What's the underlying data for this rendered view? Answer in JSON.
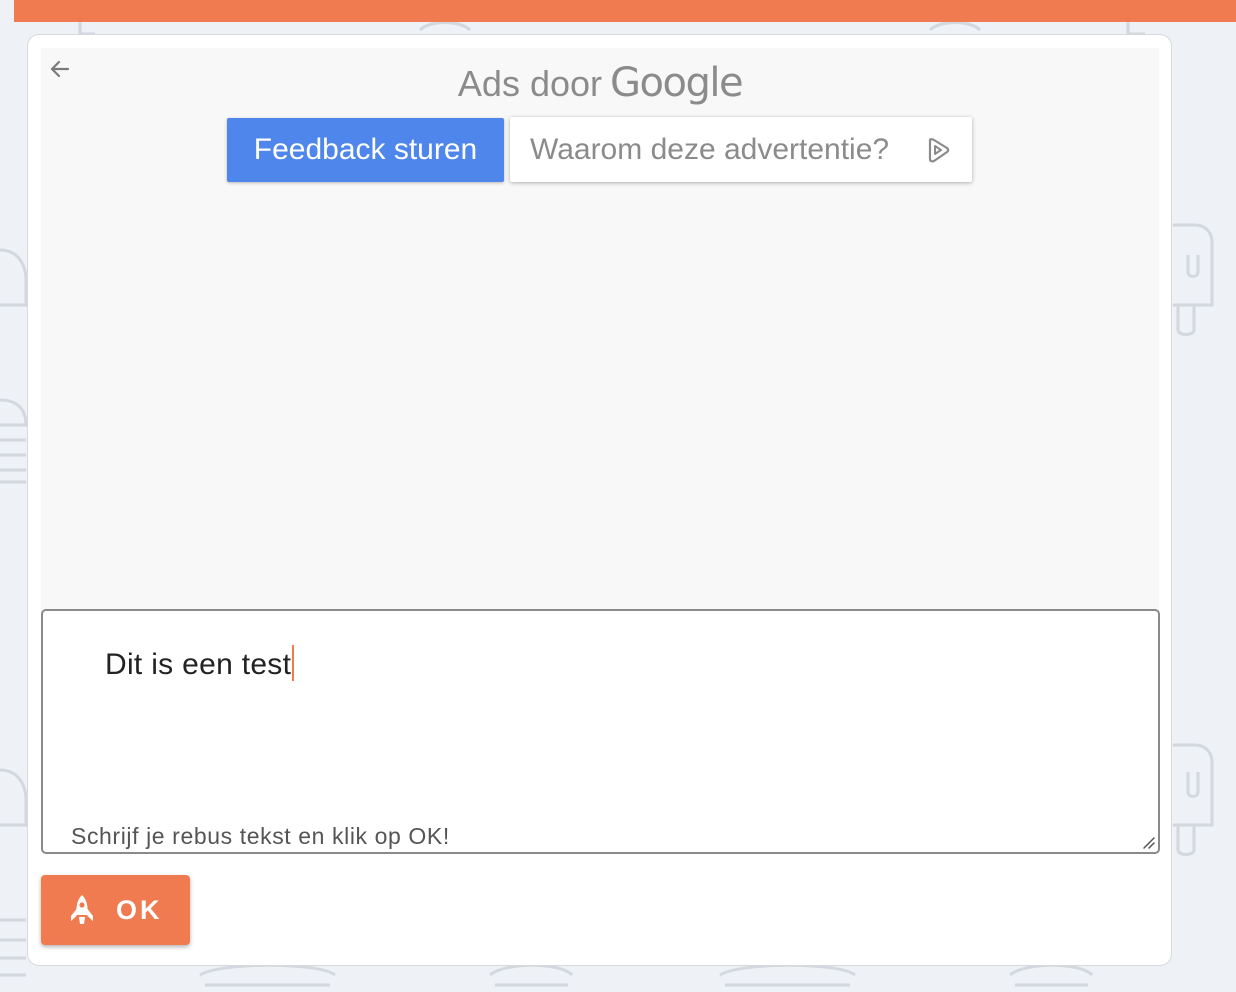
{
  "ad": {
    "title_prefix": "Ads door",
    "title_brand": "Google",
    "feedback_label": "Feedback sturen",
    "why_label": "Waarom deze advertentie?",
    "back_icon": "arrow-left-icon",
    "adchoices_icon": "adchoices-icon"
  },
  "editor": {
    "value": "Dit is een test",
    "hint": "Schrijf je rebus tekst en klik op OK!"
  },
  "ok_button": {
    "label": "OK",
    "icon": "rocket-icon"
  },
  "colors": {
    "accent": "#f07b50",
    "feedback_blue": "#4f86ec",
    "page_bg": "#eef1f5"
  }
}
